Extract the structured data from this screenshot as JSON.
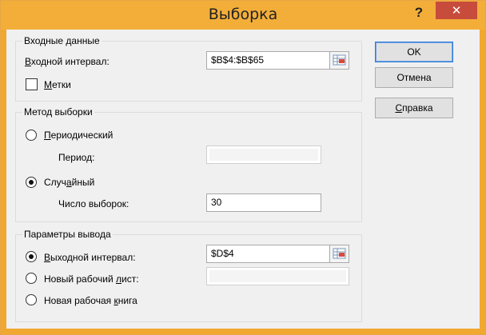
{
  "window": {
    "title": "Выборка",
    "help": "?",
    "close": "✕"
  },
  "input_group": {
    "legend": "Входные данные",
    "range_label_pre": "",
    "range_label_ul": "В",
    "range_label_post": "ходной интервал:",
    "range_value": "$B$4:$B$65",
    "labels_ul": "М",
    "labels_post": "етки",
    "labels_checked": false
  },
  "method_group": {
    "legend": "Метод выборки",
    "periodic_ul": "П",
    "periodic_post": "ериодический",
    "period_label": "Период:",
    "period_value": "",
    "random_pre": "Случ",
    "random_ul": "а",
    "random_post": "йный",
    "samples_label": "Число выборок:",
    "samples_value": "30",
    "selected": "random"
  },
  "output_group": {
    "legend": "Параметры вывода",
    "out_range_ul": "В",
    "out_range_post": "ыходной интервал:",
    "out_range_value": "$D$4",
    "new_sheet_pre": "Новый рабочий ",
    "new_sheet_ul": "л",
    "new_sheet_post": "ист:",
    "new_sheet_value": "",
    "new_book_pre": "Новая рабочая ",
    "new_book_ul": "к",
    "new_book_post": "нига",
    "selected": "output_range"
  },
  "buttons": {
    "ok": "OK",
    "cancel": "Отмена",
    "help_pre": "",
    "help_ul": "С",
    "help_post": "правка"
  },
  "colors": {
    "title_bar": "#f3ae3a",
    "close_button": "#c74c3c",
    "default_button_border": "#2f7bd9"
  },
  "icons": {
    "range_picker": "collapse-dialog-icon"
  }
}
